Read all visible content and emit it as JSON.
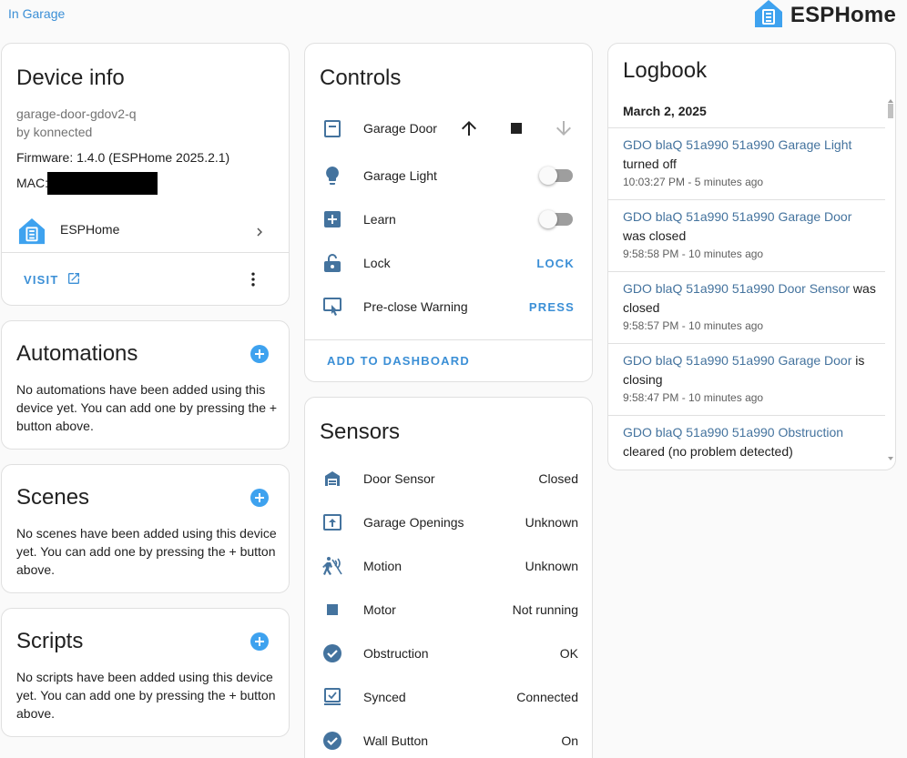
{
  "breadcrumb": {
    "area_link": "In Garage"
  },
  "brand": {
    "name": "ESPHome",
    "logo_icon": "esphome-logo-icon",
    "logo_color": "#3ea2ef"
  },
  "device_info": {
    "title": "Device info",
    "model": "garage-door-gdov2-q",
    "by": "by konnected",
    "firmware": "Firmware: 1.4.0 (ESPHome 2025.2.1)",
    "mac_label": "MAC:",
    "integration": "ESPHome",
    "visit_label": "VISIT"
  },
  "automations": {
    "title": "Automations",
    "text": "No automations have been added using this device yet. You can add one by pressing the + button above."
  },
  "scenes": {
    "title": "Scenes",
    "text": "No scenes have been added using this device yet. You can add one by pressing the + button above."
  },
  "scripts": {
    "title": "Scripts",
    "text": "No scripts have been added using this device yet. You can add one by pressing the + button above."
  },
  "controls": {
    "title": "Controls",
    "items": [
      {
        "label": "Garage Door",
        "icon": "garage-icon"
      },
      {
        "label": "Garage Light",
        "icon": "lightbulb-icon",
        "state": "off"
      },
      {
        "label": "Learn",
        "icon": "plus-box-icon",
        "state": "off"
      },
      {
        "label": "Lock",
        "icon": "lock-open-icon",
        "action": "LOCK"
      },
      {
        "label": "Pre-close Warning",
        "icon": "gesture-tap-icon",
        "action": "PRESS"
      }
    ],
    "add_to_dashboard": "ADD TO DASHBOARD"
  },
  "sensors": {
    "title": "Sensors",
    "items": [
      {
        "label": "Door Sensor",
        "value": "Closed",
        "icon": "garage-icon"
      },
      {
        "label": "Garage Openings",
        "value": "Unknown",
        "icon": "open-box-icon"
      },
      {
        "label": "Motion",
        "value": "Unknown",
        "icon": "motion-sensor-icon"
      },
      {
        "label": "Motor",
        "value": "Not running",
        "icon": "stop-icon"
      },
      {
        "label": "Obstruction",
        "value": "OK",
        "icon": "check-circle-icon"
      },
      {
        "label": "Synced",
        "value": "Connected",
        "icon": "monitor-icon"
      },
      {
        "label": "Wall Button",
        "value": "On",
        "icon": "check-circle-icon"
      }
    ]
  },
  "logbook": {
    "title": "Logbook",
    "date": "March 2, 2025",
    "entries": [
      {
        "entity": "GDO blaQ 51a990 51a990 Garage Light",
        "message": " turned off",
        "time": "10:03:27 PM - 5 minutes ago"
      },
      {
        "entity": "GDO blaQ 51a990 51a990 Garage Door",
        "message": " was closed",
        "time": "9:58:58 PM - 10 minutes ago"
      },
      {
        "entity": "GDO blaQ 51a990 51a990 Door Sensor",
        "message": " was closed",
        "time": "9:58:57 PM - 10 minutes ago"
      },
      {
        "entity": "GDO blaQ 51a990 51a990 Garage Door",
        "message": " is closing",
        "time": "9:58:47 PM - 10 minutes ago"
      },
      {
        "entity": "GDO blaQ 51a990 51a990 Obstruction",
        "message": " cleared (no problem detected)",
        "time": ""
      }
    ]
  },
  "colors": {
    "accent": "#3b8fd6",
    "icon": "#44739e",
    "entity_link": "#44739e"
  }
}
